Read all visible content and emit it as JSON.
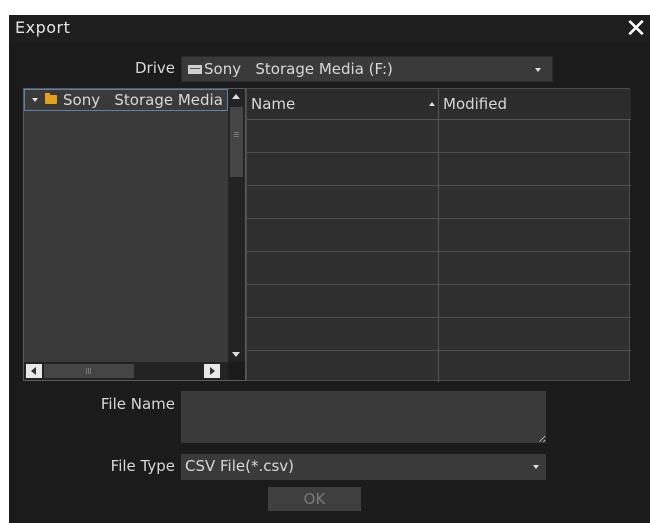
{
  "window": {
    "title": "Export",
    "close_glyph": "✕"
  },
  "drive": {
    "label": "Drive",
    "value": "Sony   Storage Media (F:)",
    "icon": "drive-icon"
  },
  "tree": {
    "items": [
      {
        "label": "Sony   Storage Media (F:)",
        "icon": "folder-icon",
        "expanded": true
      }
    ]
  },
  "file_list": {
    "columns": [
      "Name",
      "Modified"
    ],
    "rows": []
  },
  "file_name": {
    "label": "File Name",
    "value": ""
  },
  "file_type": {
    "label": "File Type",
    "value": "CSV File(*.csv)"
  },
  "ok_button": {
    "label": "OK",
    "enabled": false
  },
  "colors": {
    "background": "#1b1b1b",
    "field": "#3a3a3a",
    "tree_selection_border": "#5a7fb0",
    "folder": "#e4a21c"
  }
}
